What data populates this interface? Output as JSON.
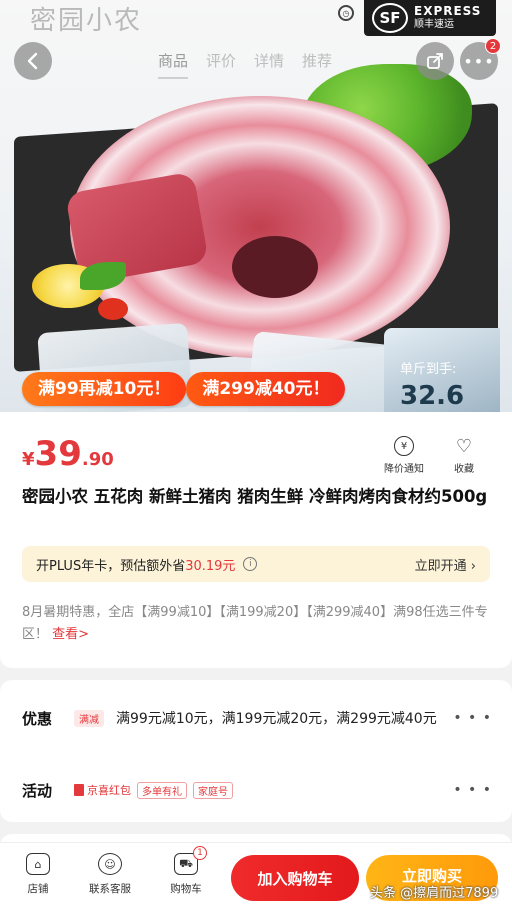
{
  "hero": {
    "brand_watermark": "密园小农",
    "sf": {
      "logo": "SF",
      "en": "EXPRESS",
      "cn": "顺丰速运"
    },
    "tabs": [
      {
        "label": "商品",
        "active": true
      },
      {
        "label": "评价",
        "active": false
      },
      {
        "label": "详情",
        "active": false
      },
      {
        "label": "推荐",
        "active": false
      }
    ],
    "more_badge": "2",
    "promo": [
      "满99再减10元！",
      "满299减40元！"
    ],
    "unit_price_label": "单斤到手:",
    "unit_price_value": "32.6"
  },
  "product": {
    "price_currency": "¥",
    "price_integer": "39",
    "price_decimal": ".90",
    "actions": [
      {
        "label": "降价通知",
        "icon": "price-drop-bell-icon"
      },
      {
        "label": "收藏",
        "icon": "heart-icon"
      }
    ],
    "title": "密园小农 五花肉 新鲜土猪肉 猪肉生鲜 冷鲜肉烤肉食材约500g",
    "plus": {
      "text": "开PLUS年卡，预估额外省",
      "save": "30.19元",
      "open": "立即开通 ›"
    },
    "desc": "8月暑期特惠，全店【满99减10】【满199减20】【满299减40】满98任选三件专区！",
    "desc_link": "查看>"
  },
  "offers": {
    "discount_label": "优惠",
    "discount_tag": "满减",
    "discount_text": "满99元减10元，满199元减20元，满299元减40元",
    "activity_label": "活动",
    "activity_brand": "京喜红包",
    "activity_tags": [
      "多单有礼",
      "家庭号"
    ],
    "dots": "• • •"
  },
  "bottom_bar": {
    "shop": "店铺",
    "service": "联系客服",
    "cart": "购物车",
    "cart_badge": "1",
    "add_to_cart": "加入购物车",
    "buy_now": "立即购买"
  },
  "watermark": "头条 @擦肩而过7899",
  "colors": {
    "accent": "#e4393c",
    "buy": "#ff9a0a"
  }
}
